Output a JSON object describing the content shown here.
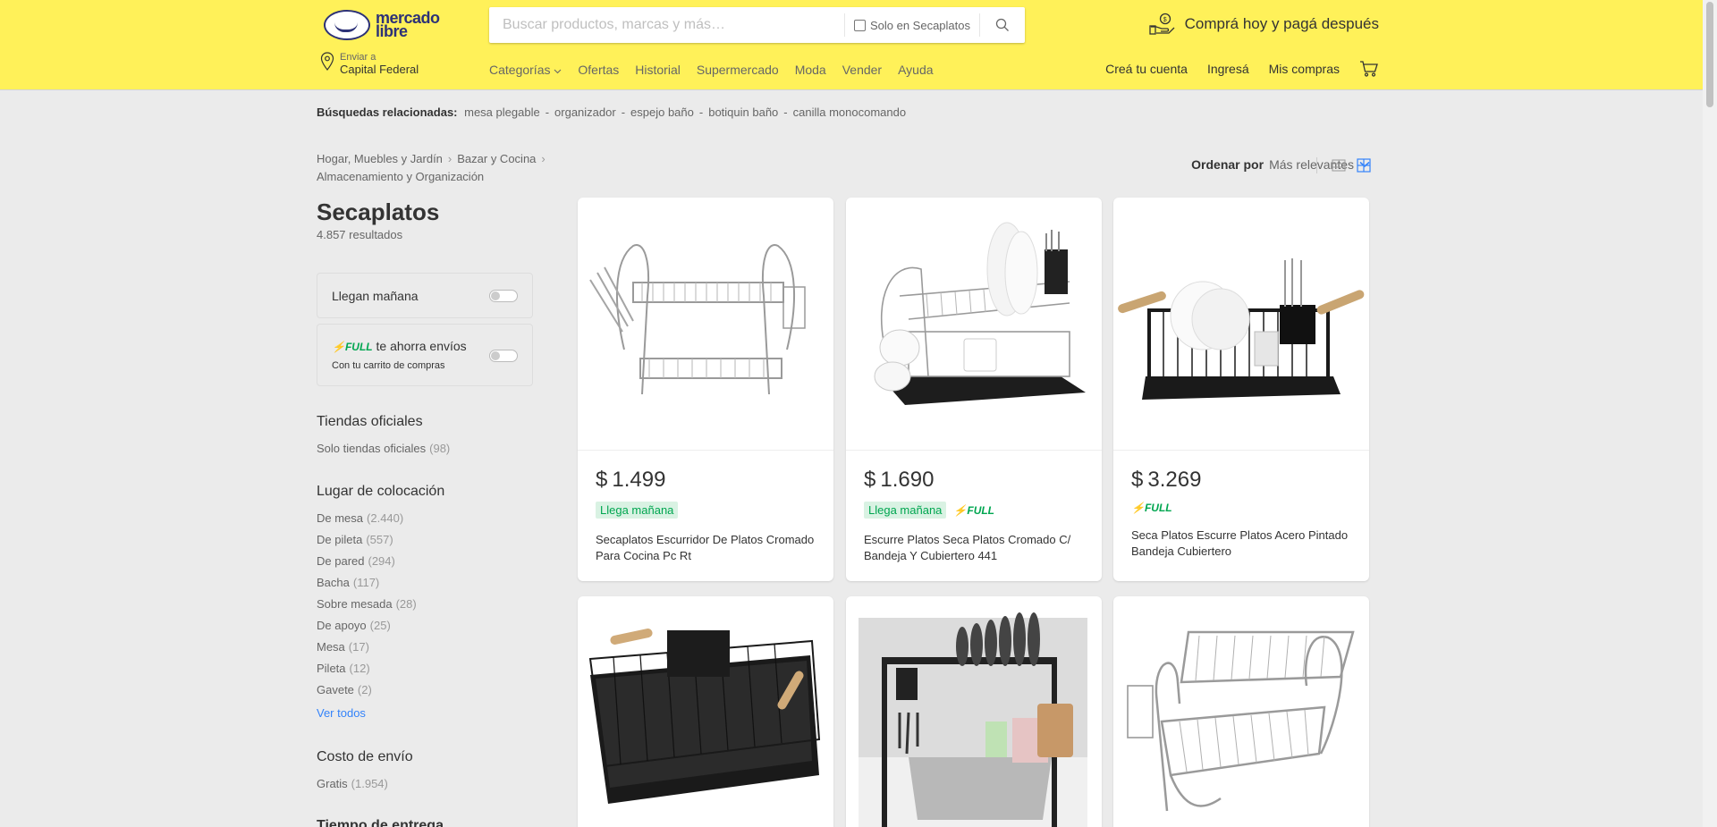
{
  "header": {
    "logo_line1": "mercado",
    "logo_line2": "libre",
    "search_placeholder": "Buscar productos, marcas y más…",
    "search_only_label": "Solo en Secaplatos",
    "promo_text": "Comprá hoy y pagá después",
    "location_label": "Enviar a",
    "location_value": "Capital Federal",
    "nav": [
      "Categorías",
      "Ofertas",
      "Historial",
      "Supermercado",
      "Moda",
      "Vender",
      "Ayuda"
    ],
    "account": [
      "Creá tu cuenta",
      "Ingresá",
      "Mis compras"
    ],
    "accent_color": "#fff159",
    "brand_color": "#2d3277"
  },
  "related": {
    "label": "Búsquedas relacionadas:",
    "items": [
      "mesa plegable",
      "organizador",
      "espejo baño",
      "botiquin baño",
      "canilla monocomando"
    ]
  },
  "breadcrumb": [
    "Hogar, Muebles y Jardín",
    "Bazar y Cocina",
    "Almacenamiento y Organización"
  ],
  "sort": {
    "label": "Ordenar por",
    "value": "Más relevantes"
  },
  "sidebar": {
    "title": "Secaplatos",
    "results": "4.857 resultados",
    "filter1": "Llegan mañana",
    "filter2_full": "FULL",
    "filter2_text": "te ahorra envíos",
    "filter2_sub": "Con tu carrito de compras",
    "official_title": "Tiendas oficiales",
    "official_option": {
      "label": "Solo tiendas oficiales",
      "count": "(98)"
    },
    "placement_title": "Lugar de colocación",
    "placement_options": [
      {
        "label": "De mesa",
        "count": "(2.440)"
      },
      {
        "label": "De pileta",
        "count": "(557)"
      },
      {
        "label": "De pared",
        "count": "(294)"
      },
      {
        "label": "Bacha",
        "count": "(117)"
      },
      {
        "label": "Sobre mesada",
        "count": "(28)"
      },
      {
        "label": "De apoyo",
        "count": "(25)"
      },
      {
        "label": "Mesa",
        "count": "(17)"
      },
      {
        "label": "Pileta",
        "count": "(12)"
      },
      {
        "label": "Gavete",
        "count": "(2)"
      }
    ],
    "see_all": "Ver todos",
    "shipping_title": "Costo de envío",
    "shipping_option": {
      "label": "Gratis",
      "count": "(1.954)"
    },
    "delivery_title": "Tiempo de entrega"
  },
  "products": [
    {
      "currency": "$",
      "price": "1.499",
      "arrives": "Llega mañana",
      "full": false,
      "name": "Secaplatos Escurridor De Platos Cromado Para Cocina Pc Rt"
    },
    {
      "currency": "$",
      "price": "1.690",
      "arrives": "Llega mañana",
      "full": true,
      "full_label": "FULL",
      "name": "Escurre Platos Seca Platos Cromado C/ Bandeja Y Cubiertero 441"
    },
    {
      "currency": "$",
      "price": "3.269",
      "arrives": "",
      "full": true,
      "full_label": "FULL",
      "name": "Seca Platos Escurre Platos Acero Pintado Bandeja Cubiertero"
    }
  ]
}
